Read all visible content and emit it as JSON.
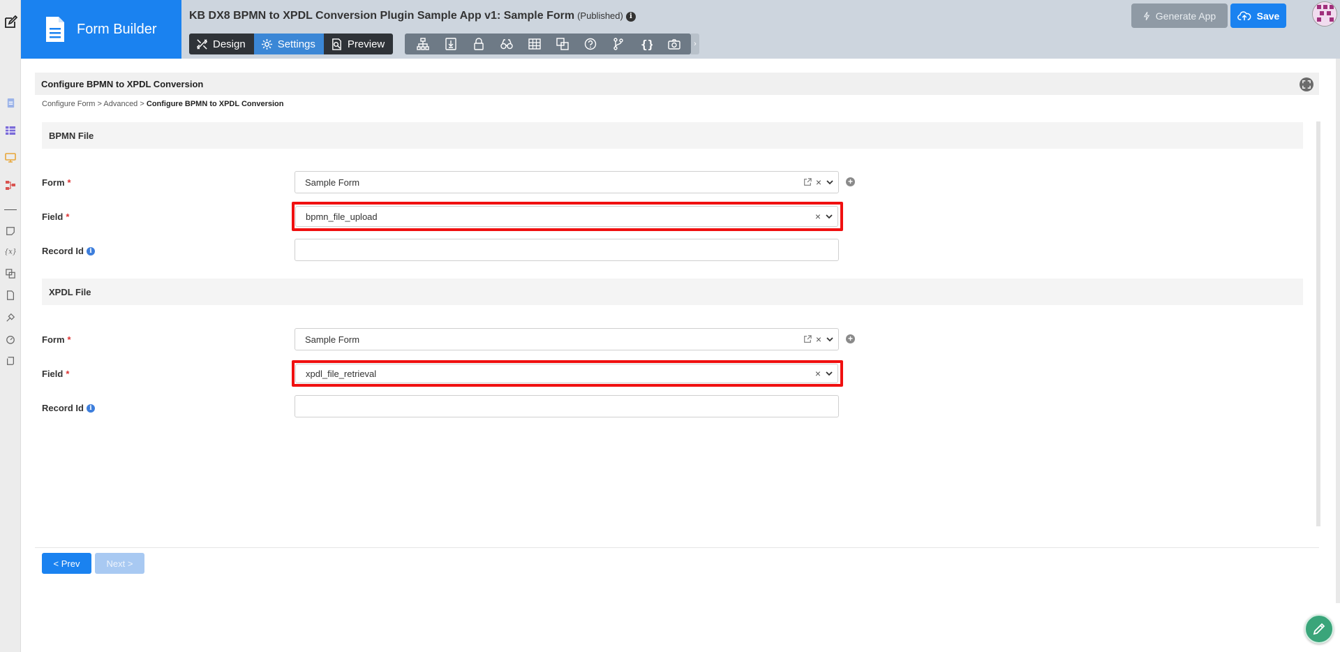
{
  "header": {
    "brand_name": "Form Builder",
    "app_title": "KB DX8 BPMN to XPDL Conversion Plugin Sample App v1: Sample Form",
    "status": "(Published)",
    "info_glyph": "i",
    "modes": [
      {
        "label": "Design",
        "icon": "design-icon"
      },
      {
        "label": "Settings",
        "icon": "gear-icon",
        "active": true
      },
      {
        "label": "Preview",
        "icon": "preview-icon"
      }
    ],
    "tools": [
      "sitemap-icon",
      "download-icon",
      "lock-icon",
      "binoculars-icon",
      "table-icon",
      "clone-icon",
      "help-icon",
      "branch-icon",
      "braces-icon",
      "camera-icon"
    ],
    "more_arrow": "›",
    "generate_label": "Generate App",
    "save_label": "Save"
  },
  "rail": {
    "icons": [
      "edit-icon",
      "form-icon",
      "datalist-icon",
      "userview-icon",
      "process-icon",
      "note-icon",
      "variable-icon",
      "clone-icon",
      "file-icon",
      "plugin-icon",
      "dashboard-icon",
      "script-icon"
    ]
  },
  "panel": {
    "title": "Configure BPMN to XPDL Conversion",
    "breadcrumb": {
      "part1": "Configure Form",
      "sep": ">",
      "part2": "Advanced",
      "current": "Configure BPMN to XPDL Conversion"
    },
    "sections": [
      {
        "title": "BPMN File",
        "form_label": "Form",
        "form_value": "Sample Form",
        "field_label": "Field",
        "field_value": "bpmn_file_upload",
        "record_label": "Record Id",
        "record_value": ""
      },
      {
        "title": "XPDL File",
        "form_label": "Form",
        "form_value": "Sample Form",
        "field_label": "Field",
        "field_value": "xpdl_file_retrieval",
        "record_label": "Record Id",
        "record_value": ""
      }
    ],
    "required_mark": "*",
    "clear_glyph": "×",
    "add_glyph": "+",
    "prev_label": "< Prev",
    "next_label": "Next >"
  },
  "colors": {
    "brand": "#1a82f0",
    "header_bg": "#cdd5de",
    "highlight": "#f01010",
    "fab": "#3aa57a"
  }
}
